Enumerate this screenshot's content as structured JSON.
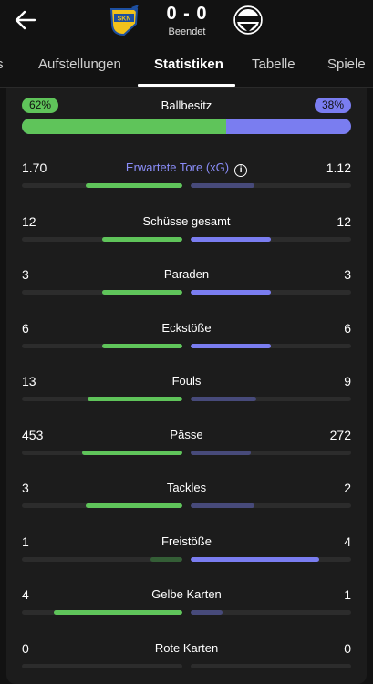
{
  "match": {
    "score": "0 - 0",
    "status": "Beendet",
    "home_logo": "skn-crest-icon",
    "away_logo": "away-crest-icon"
  },
  "tabs": [
    "s",
    "Aufstellungen",
    "Statistiken",
    "Tabelle",
    "Spiele"
  ],
  "active_tab": "Statistiken",
  "colors": {
    "home": "#5fc45a",
    "away": "#7a7df0",
    "home_dim": "#345e36",
    "away_dim": "#474a7a"
  },
  "possession": {
    "label": "Ballbesitz",
    "home": "62%",
    "away": "38%",
    "home_fraction": 0.62
  },
  "stats": [
    {
      "label": "Erwartete Tore (xG)",
      "home": "1.70",
      "away": "1.12",
      "h": 1.7,
      "a": 1.12,
      "link": true
    },
    {
      "label": "Schüsse gesamt",
      "home": "12",
      "away": "12",
      "h": 12,
      "a": 12
    },
    {
      "label": "Paraden",
      "home": "3",
      "away": "3",
      "h": 3,
      "a": 3
    },
    {
      "label": "Eckstöße",
      "home": "6",
      "away": "6",
      "h": 6,
      "a": 6
    },
    {
      "label": "Fouls",
      "home": "13",
      "away": "9",
      "h": 13,
      "a": 9
    },
    {
      "label": "Pässe",
      "home": "453",
      "away": "272",
      "h": 453,
      "a": 272
    },
    {
      "label": "Tackles",
      "home": "3",
      "away": "2",
      "h": 3,
      "a": 2
    },
    {
      "label": "Freistöße",
      "home": "1",
      "away": "4",
      "h": 1,
      "a": 4
    },
    {
      "label": "Gelbe Karten",
      "home": "4",
      "away": "1",
      "h": 4,
      "a": 1
    },
    {
      "label": "Rote Karten",
      "home": "0",
      "away": "0",
      "h": 0,
      "a": 0
    }
  ]
}
